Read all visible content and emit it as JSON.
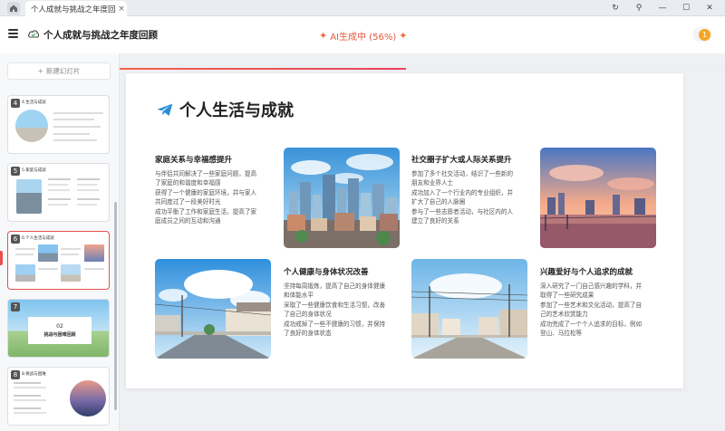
{
  "tab": {
    "title": "个人成就与挑战之年度回顾",
    "close": "×"
  },
  "window_controls": {
    "refresh": "↻",
    "pin": "⚲",
    "minimize": "—",
    "maximize": "☐",
    "close": "✕"
  },
  "header": {
    "doc_title": "个人成就与挑战之年度回顾",
    "ai_status": "AI生成中 (56%)",
    "ai_progress": 0.56,
    "user_count": "1"
  },
  "sidebar": {
    "new_slide": "新建幻灯片",
    "thumbs": [
      {
        "num": "4",
        "caption": "4.生活与成就"
      },
      {
        "num": "5",
        "caption": "5.家庭与成就"
      },
      {
        "num": "6",
        "caption": "6.个人生活与成就"
      },
      {
        "num": "7",
        "caption": "02",
        "subtitle": "挑战与困难回顾"
      },
      {
        "num": "8",
        "caption": "8.挑战与困难"
      }
    ]
  },
  "slide": {
    "title": "个人生活与成就",
    "cards": [
      {
        "title": "家庭关系与幸福感提升",
        "lines": [
          "与伴侣共同解决了一些家庭问题，提高",
          "了家庭的和谐度和幸福感",
          "获得了一个健康的家庭环境，并与家人",
          "共同度过了一段美好时光",
          "成功平衡了工作和家庭生活，提高了家",
          "庭成员之间的互动和沟通"
        ]
      },
      {
        "title": "社交圈子扩大或人际关系提升",
        "lines": [
          "参加了多个社交活动，结识了一些新的",
          "朋友和业界人士",
          "成功加入了一个行业内的专业组织，并",
          "扩大了自己的人脉圈",
          "参与了一些志愿者活动，与社区内的人",
          "建立了良好的关系"
        ]
      },
      {
        "title": "个人健康与身体状况改善",
        "lines": [
          "坚持每周锻炼，提高了自己的身体健康",
          "和体能水平",
          "采取了一些健康饮食和生活习惯，改善",
          "了自己的身体状况",
          "成功戒掉了一些不健康的习惯，并保持",
          "了良好的身体状态"
        ]
      },
      {
        "title": "兴趣爱好与个人追求的成就",
        "lines": [
          "深入研究了一门自己感兴趣的学科，并",
          "取得了一些研究成果",
          "参加了一些艺术和文化活动，提高了自",
          "己的艺术欣赏能力",
          "成功完成了一个个人追求的目标，例如",
          "登山、马拉松等"
        ]
      }
    ]
  },
  "colors": {
    "accent": "#e8435c",
    "ai_text": "#e5583b",
    "badge": "#f5a623"
  }
}
